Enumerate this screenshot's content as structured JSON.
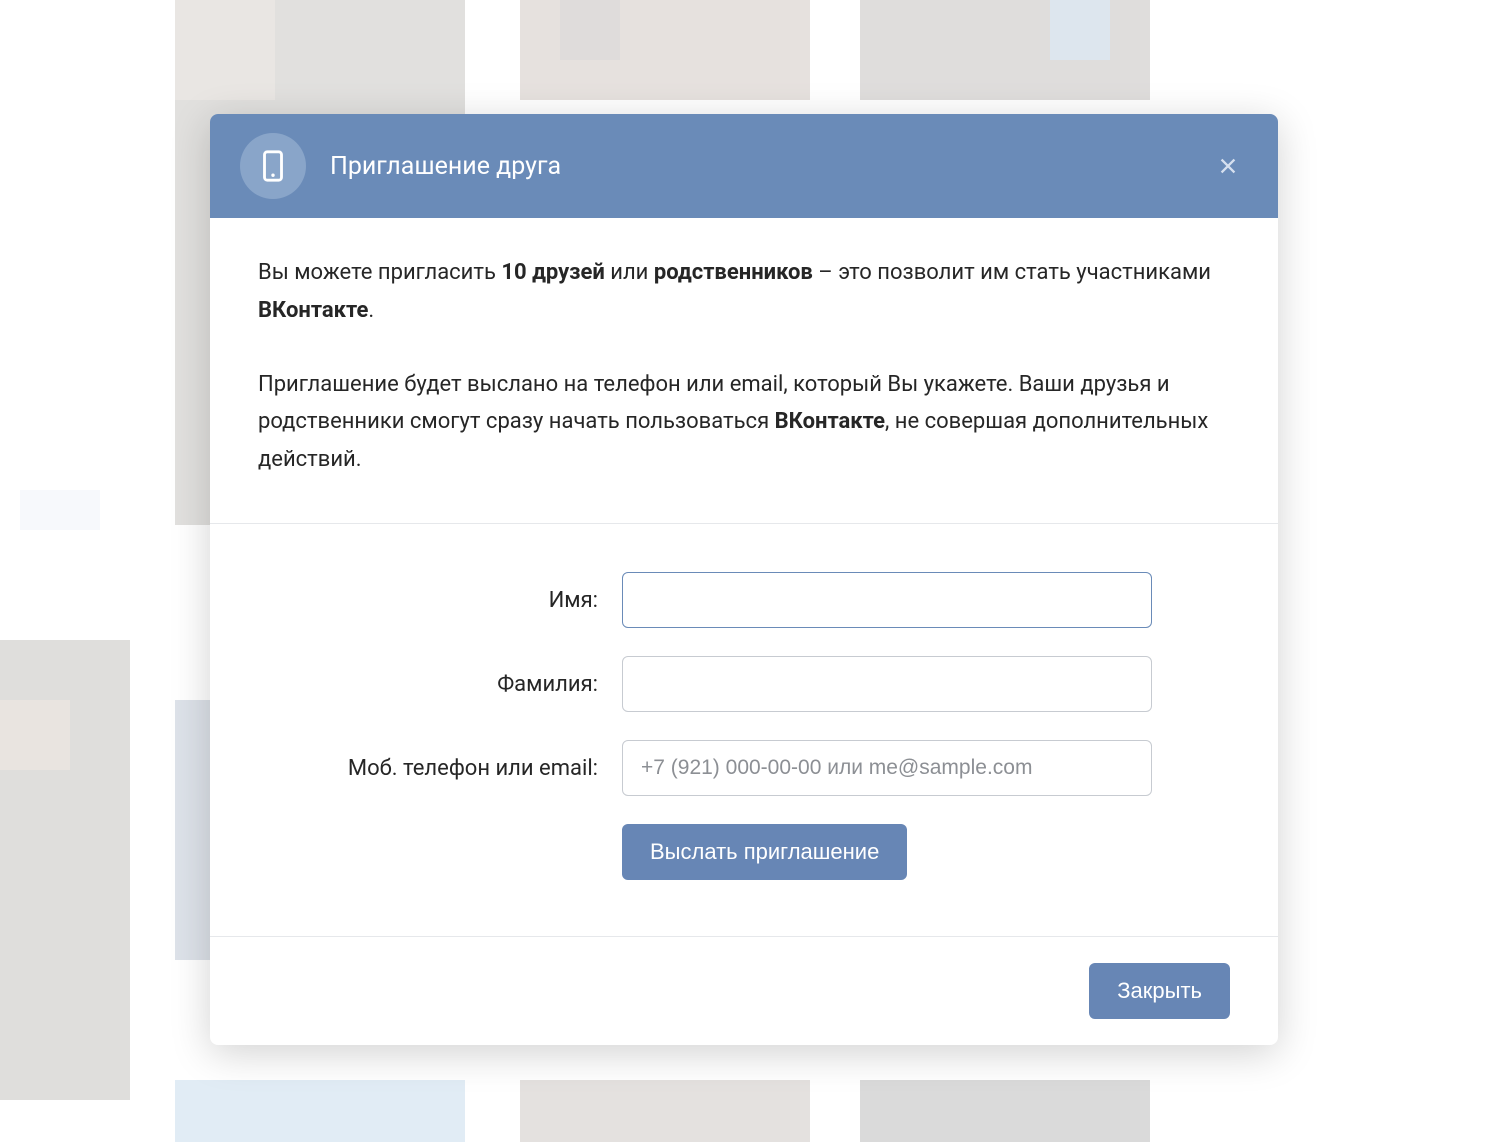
{
  "modal": {
    "title": "Приглашение друга",
    "intro_prefix": "Вы можете пригласить ",
    "intro_bold1": "10 друзей",
    "intro_mid1": " или ",
    "intro_bold2": "родственников",
    "intro_suffix": " – это позволит им стать участниками ",
    "intro_bold3": "ВКонтакте",
    "intro_end": ".",
    "para2_prefix": "Приглашение будет выслано на телефон или email, который Вы укажете. Ваши друзья и родственники смогут сразу начать пользоваться ",
    "para2_bold": "ВКонтакте",
    "para2_suffix": ", не совершая дополнительных действий.",
    "labels": {
      "firstname": "Имя:",
      "lastname": "Фамилия:",
      "contact": "Моб. телефон или email:"
    },
    "placeholders": {
      "contact": "+7 (921) 000-00-00 или me@sample.com"
    },
    "buttons": {
      "submit": "Выслать приглашение",
      "close": "Закрыть"
    }
  }
}
